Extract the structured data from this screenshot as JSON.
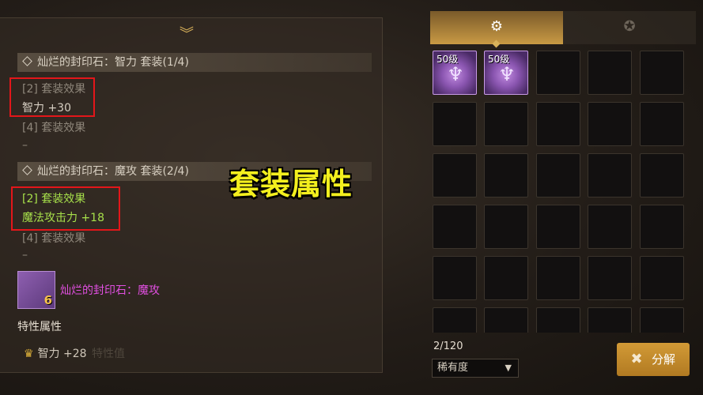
{
  "left": {
    "sets": [
      {
        "header": "灿烂的封印石：智力 套装(1/4)",
        "effects": [
          {
            "title": "[2] 套装效果",
            "value": "智力 +30"
          },
          {
            "title": "[4] 套装效果",
            "value": "–"
          }
        ]
      },
      {
        "header": "灿烂的封印石：魔攻 套装(2/4)",
        "effects": [
          {
            "title": "[2] 套装效果",
            "value": "魔法攻击力 +18"
          },
          {
            "title": "[4] 套装效果",
            "value": "–"
          }
        ]
      }
    ],
    "overlay_title": "套装属性",
    "item": {
      "name": "灿烂的封印石：魔攻",
      "badge": "6"
    },
    "trait_section": "特性属性",
    "trait_stat": "智力 +28",
    "ghost_label": "特性值"
  },
  "inventory": {
    "slots": [
      {
        "level": "50级"
      },
      {
        "level": "50级"
      }
    ],
    "capacity": "2/120",
    "sort_label": "稀有度",
    "decompose_label": "分解"
  },
  "colors": {
    "accent": "#d9b25a",
    "active_effect": "#a7e04a",
    "highlight_box": "#e3161a",
    "item_name": "#e04fe0"
  }
}
